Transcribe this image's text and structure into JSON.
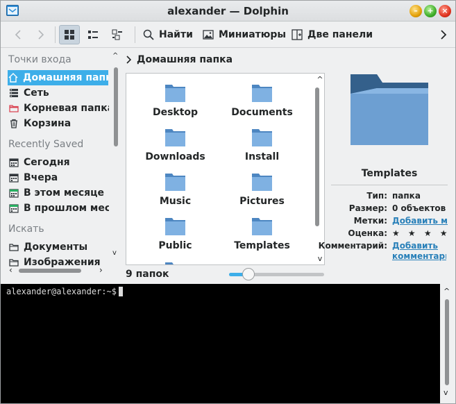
{
  "window": {
    "title": "alexander — Dolphin"
  },
  "toolbar": {
    "find_label": "Найти",
    "preview_label": "Миниатюры",
    "split_label": "Две панели"
  },
  "places": {
    "group_entry": "Точки входа",
    "entries": [
      {
        "label": "Домашняя папка",
        "icon": "home-icon"
      },
      {
        "label": "Сеть",
        "icon": "network-icon"
      },
      {
        "label": "Корневая папка",
        "icon": "root-folder-icon"
      },
      {
        "label": "Корзина",
        "icon": "trash-icon"
      }
    ],
    "group_recent": "Recently Saved",
    "recent": [
      {
        "label": "Сегодня",
        "icon": "calendar-icon"
      },
      {
        "label": "Вчера",
        "icon": "calendar-icon"
      },
      {
        "label": "В этом месяце",
        "icon": "calendar-icon"
      },
      {
        "label": "В прошлом месяце",
        "icon": "calendar-icon"
      }
    ],
    "group_search": "Искать",
    "search": [
      {
        "label": "Документы",
        "icon": "folder-icon"
      },
      {
        "label": "Изображения",
        "icon": "folder-icon"
      }
    ]
  },
  "breadcrumb": {
    "current": "Домашняя папка"
  },
  "files": [
    {
      "name": "Desktop"
    },
    {
      "name": "Documents"
    },
    {
      "name": "Downloads"
    },
    {
      "name": "Install"
    },
    {
      "name": "Music"
    },
    {
      "name": "Pictures"
    },
    {
      "name": "Public"
    },
    {
      "name": "Templates"
    }
  ],
  "status": {
    "count_text": "9 папок",
    "zoom_fraction": 0.16
  },
  "info": {
    "name": "Templates",
    "rows": [
      {
        "key": "Тип:",
        "value": "папка"
      },
      {
        "key": "Размер:",
        "value": "0 объектов"
      },
      {
        "key": "Метки:",
        "value": "Добавить метки"
      },
      {
        "key": "Оценка:",
        "value": "★ ★ ★ ★ ★"
      },
      {
        "key": "Комментарий:",
        "value": "Добавить комментарий"
      }
    ]
  },
  "terminal": {
    "prompt": "alexander@alexander:~$"
  },
  "colors": {
    "accent": "#3daee9",
    "folder": "#6b9fd4",
    "terminal_bg": "#000000"
  }
}
